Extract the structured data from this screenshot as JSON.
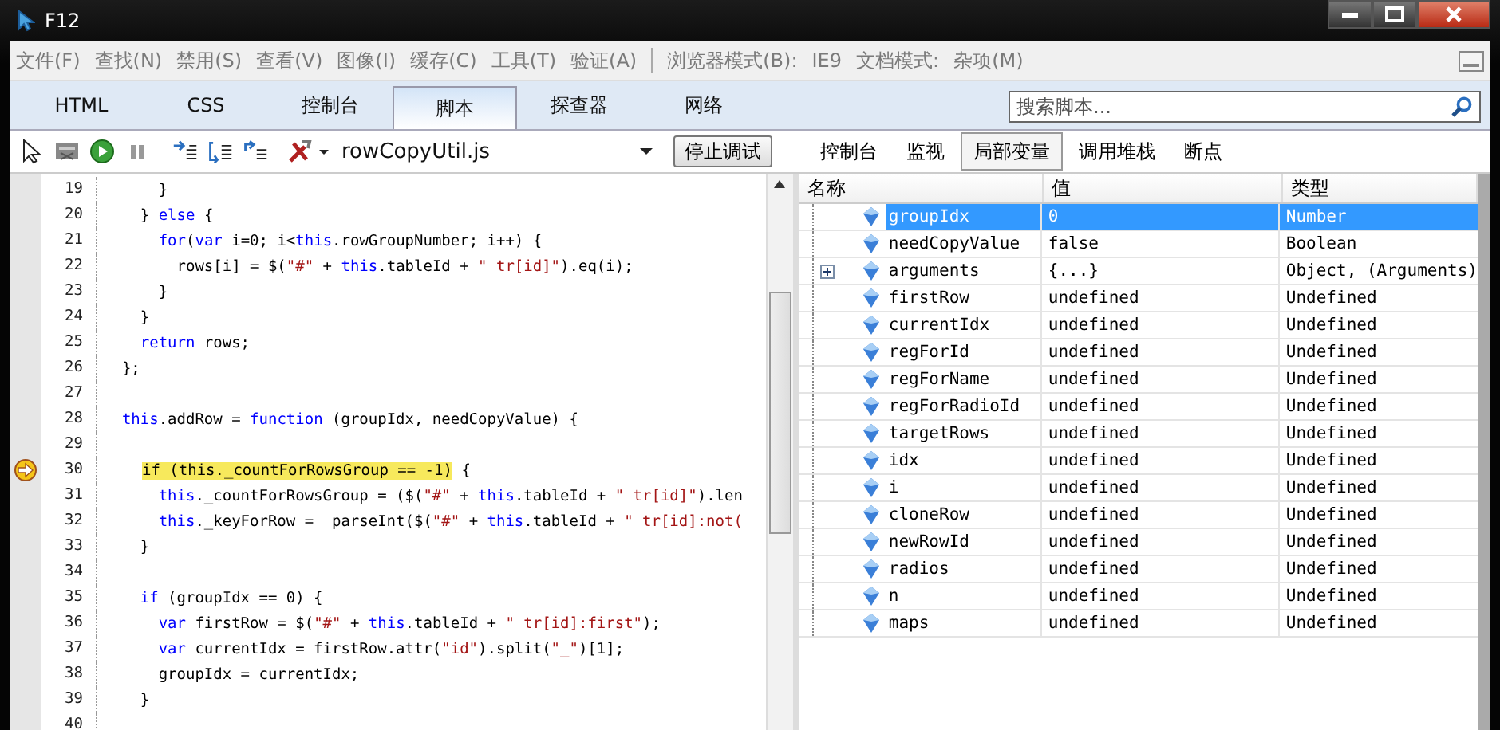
{
  "window": {
    "title": "F12"
  },
  "menu": [
    {
      "label": "文件(F)"
    },
    {
      "label": "查找(N)"
    },
    {
      "label": "禁用(S)"
    },
    {
      "label": "查看(V)"
    },
    {
      "label": "图像(I)"
    },
    {
      "label": "缓存(C)"
    },
    {
      "label": "工具(T)"
    },
    {
      "label": "验证(A)"
    }
  ],
  "mode_items": [
    {
      "label": "浏览器模式(B):"
    },
    {
      "label": "IE9"
    },
    {
      "label": "文档模式:"
    },
    {
      "label": "杂项(M)"
    }
  ],
  "tabs": [
    {
      "label": "HTML",
      "selected": false
    },
    {
      "label": "CSS",
      "selected": false
    },
    {
      "label": "控制台",
      "selected": false
    },
    {
      "label": "脚本",
      "selected": true
    },
    {
      "label": "探查器",
      "selected": false
    },
    {
      "label": "网络",
      "selected": false
    }
  ],
  "search": {
    "placeholder": "搜索脚本..."
  },
  "toolbar": {
    "file": "rowCopyUtil.js",
    "stop_button": "停止调试"
  },
  "side_tabs": [
    {
      "label": "控制台",
      "selected": false
    },
    {
      "label": "监视",
      "selected": false
    },
    {
      "label": "局部变量",
      "selected": true
    },
    {
      "label": "调用堆栈",
      "selected": false
    },
    {
      "label": "断点",
      "selected": false
    }
  ],
  "code": [
    {
      "number": "19",
      "tokens": [
        {
          "kind": "plain",
          "text": "      }"
        }
      ]
    },
    {
      "number": "20",
      "tokens": [
        {
          "kind": "plain",
          "text": "    } "
        },
        {
          "kind": "kw",
          "text": "else"
        },
        {
          "kind": "plain",
          "text": " {"
        }
      ]
    },
    {
      "number": "21",
      "tokens": [
        {
          "kind": "kw",
          "text": "      for"
        },
        {
          "kind": "plain",
          "text": "("
        },
        {
          "kind": "kw",
          "text": "var"
        },
        {
          "kind": "plain",
          "text": " i=0; i<"
        },
        {
          "kind": "kw",
          "text": "this"
        },
        {
          "kind": "plain",
          "text": ".rowGroupNumber; i++) {"
        }
      ]
    },
    {
      "number": "22",
      "tokens": [
        {
          "kind": "plain",
          "text": "        rows[i] = $("
        },
        {
          "kind": "str",
          "text": "\"#\""
        },
        {
          "kind": "plain",
          "text": " + "
        },
        {
          "kind": "kw",
          "text": "this"
        },
        {
          "kind": "plain",
          "text": ".tableId + "
        },
        {
          "kind": "str",
          "text": "\" tr[id]\""
        },
        {
          "kind": "plain",
          "text": ").eq(i);"
        }
      ]
    },
    {
      "number": "23",
      "tokens": [
        {
          "kind": "plain",
          "text": "      }"
        }
      ]
    },
    {
      "number": "24",
      "tokens": [
        {
          "kind": "plain",
          "text": "    }"
        }
      ]
    },
    {
      "number": "25",
      "tokens": [
        {
          "kind": "kw",
          "text": "    return"
        },
        {
          "kind": "plain",
          "text": " rows;"
        }
      ]
    },
    {
      "number": "26",
      "tokens": [
        {
          "kind": "plain",
          "text": "  };"
        }
      ]
    },
    {
      "number": "27"
    },
    {
      "number": "28",
      "tokens": [
        {
          "kind": "kw",
          "text": "  this"
        },
        {
          "kind": "plain",
          "text": ".addRow = "
        },
        {
          "kind": "kw",
          "text": "function"
        },
        {
          "kind": "plain",
          "text": " (groupIdx, needCopyValue) {"
        }
      ]
    },
    {
      "number": "29"
    },
    {
      "number": "30",
      "current": true,
      "tokens": [
        {
          "kind": "mark",
          "text": "if (this._countForRowsGroup == -1)"
        },
        {
          "kind": "plain",
          "text": " {"
        }
      ]
    },
    {
      "number": "31",
      "tokens": [
        {
          "kind": "kw",
          "text": "      this"
        },
        {
          "kind": "plain",
          "text": "._countForRowsGroup = ($("
        },
        {
          "kind": "str",
          "text": "\"#\""
        },
        {
          "kind": "plain",
          "text": " + "
        },
        {
          "kind": "kw",
          "text": "this"
        },
        {
          "kind": "plain",
          "text": ".tableId + "
        },
        {
          "kind": "str",
          "text": "\" tr[id]\""
        },
        {
          "kind": "plain",
          "text": ").len"
        }
      ]
    },
    {
      "number": "32",
      "tokens": [
        {
          "kind": "kw",
          "text": "      this"
        },
        {
          "kind": "plain",
          "text": "._keyForRow =  parseInt($("
        },
        {
          "kind": "str",
          "text": "\"#\""
        },
        {
          "kind": "plain",
          "text": " + "
        },
        {
          "kind": "kw",
          "text": "this"
        },
        {
          "kind": "plain",
          "text": ".tableId + "
        },
        {
          "kind": "str",
          "text": "\" tr[id]:not("
        }
      ]
    },
    {
      "number": "33",
      "tokens": [
        {
          "kind": "plain",
          "text": "    }"
        }
      ]
    },
    {
      "number": "34"
    },
    {
      "number": "35",
      "tokens": [
        {
          "kind": "kw",
          "text": "    if"
        },
        {
          "kind": "plain",
          "text": " (groupIdx == 0) {"
        }
      ]
    },
    {
      "number": "36",
      "tokens": [
        {
          "kind": "kw",
          "text": "      var"
        },
        {
          "kind": "plain",
          "text": " firstRow = $("
        },
        {
          "kind": "str",
          "text": "\"#\""
        },
        {
          "kind": "plain",
          "text": " + "
        },
        {
          "kind": "kw",
          "text": "this"
        },
        {
          "kind": "plain",
          "text": ".tableId + "
        },
        {
          "kind": "str",
          "text": "\" tr[id]:first\""
        },
        {
          "kind": "plain",
          "text": ");"
        }
      ]
    },
    {
      "number": "37",
      "tokens": [
        {
          "kind": "kw",
          "text": "      var"
        },
        {
          "kind": "plain",
          "text": " currentIdx = firstRow.attr("
        },
        {
          "kind": "str",
          "text": "\"id\""
        },
        {
          "kind": "plain",
          "text": ").split("
        },
        {
          "kind": "str",
          "text": "\"_\""
        },
        {
          "kind": "plain",
          "text": ")[1];"
        }
      ]
    },
    {
      "number": "38",
      "tokens": [
        {
          "kind": "plain",
          "text": "      groupIdx = currentIdx;"
        }
      ]
    },
    {
      "number": "39",
      "tokens": [
        {
          "kind": "plain",
          "text": "    }"
        }
      ]
    },
    {
      "number": "40"
    }
  ],
  "locals": {
    "columns": [
      "名称",
      "值",
      "类型"
    ],
    "rows": [
      {
        "name": "groupIdx",
        "value": "0",
        "type": "Number",
        "selected": true
      },
      {
        "name": "needCopyValue",
        "value": "false",
        "type": "Boolean",
        "selected": false
      },
      {
        "name": "arguments",
        "value": "{...}",
        "type": "Object, (Arguments)",
        "selected": false,
        "expandable": true
      },
      {
        "name": "firstRow",
        "value": "undefined",
        "type": "Undefined",
        "selected": false
      },
      {
        "name": "currentIdx",
        "value": "undefined",
        "type": "Undefined",
        "selected": false
      },
      {
        "name": "regForId",
        "value": "undefined",
        "type": "Undefined",
        "selected": false
      },
      {
        "name": "regForName",
        "value": "undefined",
        "type": "Undefined",
        "selected": false
      },
      {
        "name": "regForRadioId",
        "value": "undefined",
        "type": "Undefined",
        "selected": false
      },
      {
        "name": "targetRows",
        "value": "undefined",
        "type": "Undefined",
        "selected": false
      },
      {
        "name": "idx",
        "value": "undefined",
        "type": "Undefined",
        "selected": false
      },
      {
        "name": "i",
        "value": "undefined",
        "type": "Undefined",
        "selected": false
      },
      {
        "name": "cloneRow",
        "value": "undefined",
        "type": "Undefined",
        "selected": false
      },
      {
        "name": "newRowId",
        "value": "undefined",
        "type": "Undefined",
        "selected": false
      },
      {
        "name": "radios",
        "value": "undefined",
        "type": "Undefined",
        "selected": false
      },
      {
        "name": "n",
        "value": "undefined",
        "type": "Undefined",
        "selected": false
      },
      {
        "name": "maps",
        "value": "undefined",
        "type": "Undefined",
        "selected": false
      }
    ]
  }
}
